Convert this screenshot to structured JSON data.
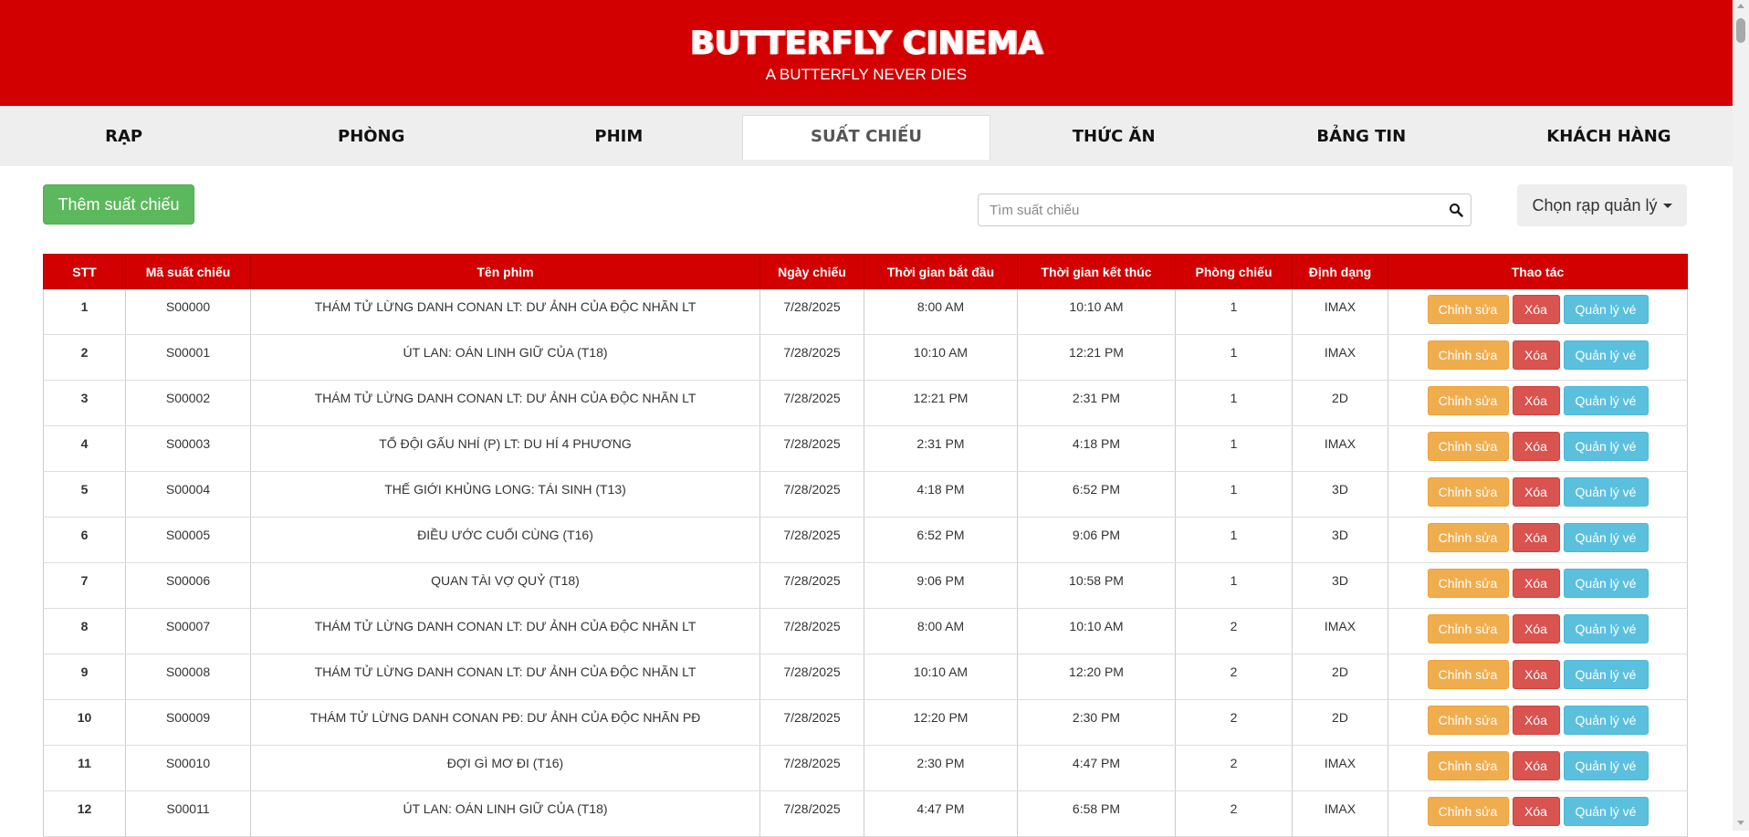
{
  "header": {
    "brand": "BUTTERFLY CINEMA",
    "tagline": "A BUTTERFLY NEVER DIES"
  },
  "nav": {
    "items": [
      {
        "label": "RẠP"
      },
      {
        "label": "PHÒNG"
      },
      {
        "label": "PHIM"
      },
      {
        "label": "SUẤT CHIẾU",
        "active": true
      },
      {
        "label": "THỨC ĂN"
      },
      {
        "label": "BẢNG TIN"
      },
      {
        "label": "KHÁCH HÀNG"
      }
    ]
  },
  "toolbar": {
    "add_label": "Thêm suất chiếu",
    "search_placeholder": "Tìm suất chiếu",
    "cinema_select_label": "Chọn rạp quản lý"
  },
  "table": {
    "headers": [
      "STT",
      "Mã suất chiếu",
      "Tên phim",
      "Ngày chiếu",
      "Thời gian bắt đầu",
      "Thời gian kết thúc",
      "Phòng chiếu",
      "Định dạng",
      "Thao tác"
    ],
    "action_labels": {
      "edit": "Chỉnh sửa",
      "delete": "Xóa",
      "tickets": "Quản lý vé"
    },
    "rows": [
      {
        "stt": "1",
        "code": "S00000",
        "movie": "THÁM TỬ LỪNG DANH CONAN LT: DƯ ẢNH CỦA ĐỘC NHÃN LT",
        "date": "7/28/2025",
        "start": "8:00 AM",
        "end": "10:10 AM",
        "room": "1",
        "format": "IMAX"
      },
      {
        "stt": "2",
        "code": "S00001",
        "movie": "ÚT LAN: OÁN LINH GIỮ CỦA (T18)",
        "date": "7/28/2025",
        "start": "10:10 AM",
        "end": "12:21 PM",
        "room": "1",
        "format": "IMAX"
      },
      {
        "stt": "3",
        "code": "S00002",
        "movie": "THÁM TỬ LỪNG DANH CONAN LT: DƯ ẢNH CỦA ĐỘC NHÃN LT",
        "date": "7/28/2025",
        "start": "12:21 PM",
        "end": "2:31 PM",
        "room": "1",
        "format": "2D"
      },
      {
        "stt": "4",
        "code": "S00003",
        "movie": "TỔ ĐỘI GẤU NHÍ (P) LT: DU HÍ 4 PHƯƠNG",
        "date": "7/28/2025",
        "start": "2:31 PM",
        "end": "4:18 PM",
        "room": "1",
        "format": "IMAX"
      },
      {
        "stt": "5",
        "code": "S00004",
        "movie": "THẾ GIỚI KHỦNG LONG: TÁI SINH (T13)",
        "date": "7/28/2025",
        "start": "4:18 PM",
        "end": "6:52 PM",
        "room": "1",
        "format": "3D"
      },
      {
        "stt": "6",
        "code": "S00005",
        "movie": "ĐIỀU ƯỚC CUỐI CÙNG (T16)",
        "date": "7/28/2025",
        "start": "6:52 PM",
        "end": "9:06 PM",
        "room": "1",
        "format": "3D"
      },
      {
        "stt": "7",
        "code": "S00006",
        "movie": "QUAN TÀI VỢ QUỶ (T18)",
        "date": "7/28/2025",
        "start": "9:06 PM",
        "end": "10:58 PM",
        "room": "1",
        "format": "3D"
      },
      {
        "stt": "8",
        "code": "S00007",
        "movie": "THÁM TỬ LỪNG DANH CONAN LT: DƯ ẢNH CỦA ĐỘC NHÃN LT",
        "date": "7/28/2025",
        "start": "8:00 AM",
        "end": "10:10 AM",
        "room": "2",
        "format": "IMAX"
      },
      {
        "stt": "9",
        "code": "S00008",
        "movie": "THÁM TỬ LỪNG DANH CONAN LT: DƯ ẢNH CỦA ĐỘC NHÃN LT",
        "date": "7/28/2025",
        "start": "10:10 AM",
        "end": "12:20 PM",
        "room": "2",
        "format": "2D"
      },
      {
        "stt": "10",
        "code": "S00009",
        "movie": "THÁM TỬ LỪNG DANH CONAN PĐ: DƯ ẢNH CỦA ĐỘC NHÃN PĐ",
        "date": "7/28/2025",
        "start": "12:20 PM",
        "end": "2:30 PM",
        "room": "2",
        "format": "2D"
      },
      {
        "stt": "11",
        "code": "S00010",
        "movie": "ĐỢI GÌ MƠ ĐI (T16)",
        "date": "7/28/2025",
        "start": "2:30 PM",
        "end": "4:47 PM",
        "room": "2",
        "format": "IMAX"
      },
      {
        "stt": "12",
        "code": "S00011",
        "movie": "ÚT LAN: OÁN LINH GIỮ CỦA (T18)",
        "date": "7/28/2025",
        "start": "4:47 PM",
        "end": "6:58 PM",
        "room": "2",
        "format": "IMAX"
      }
    ]
  }
}
